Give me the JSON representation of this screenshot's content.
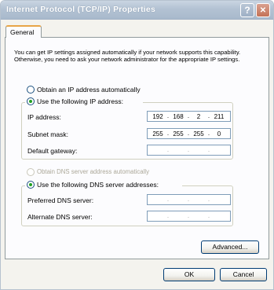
{
  "window": {
    "title": "Internet Protocol (TCP/IP) Properties",
    "help_glyph": "?",
    "close_glyph": "✕"
  },
  "tabs": [
    {
      "label": "General"
    }
  ],
  "intro_text": "You can get IP settings assigned automatically if your network supports this capability. Otherwise, you need to ask your network administrator for the appropriate IP settings.",
  "ip_mode": {
    "auto_label": "Obtain an IP address automatically",
    "manual_label": "Use the following IP address:",
    "selected": "manual"
  },
  "ip_fields": {
    "ip_address": {
      "label": "IP address:",
      "octets": [
        "192",
        "168",
        "2",
        "211"
      ]
    },
    "subnet_mask": {
      "label": "Subnet mask:",
      "octets": [
        "255",
        "255",
        "255",
        "0"
      ]
    },
    "default_gateway": {
      "label": "Default gateway:",
      "octets": [
        "",
        "",
        "",
        ""
      ]
    }
  },
  "dns_mode": {
    "auto_label": "Obtain DNS server address automatically",
    "manual_label": "Use the following DNS server addresses:",
    "selected": "manual",
    "auto_disabled": true
  },
  "dns_fields": {
    "preferred": {
      "label": "Preferred DNS server:",
      "octets": [
        "",
        "",
        "",
        ""
      ]
    },
    "alternate": {
      "label": "Alternate DNS server:",
      "octets": [
        "",
        "",
        "",
        ""
      ]
    }
  },
  "ip_separator": ".",
  "buttons": {
    "advanced": "Advanced...",
    "ok": "OK",
    "cancel": "Cancel"
  }
}
